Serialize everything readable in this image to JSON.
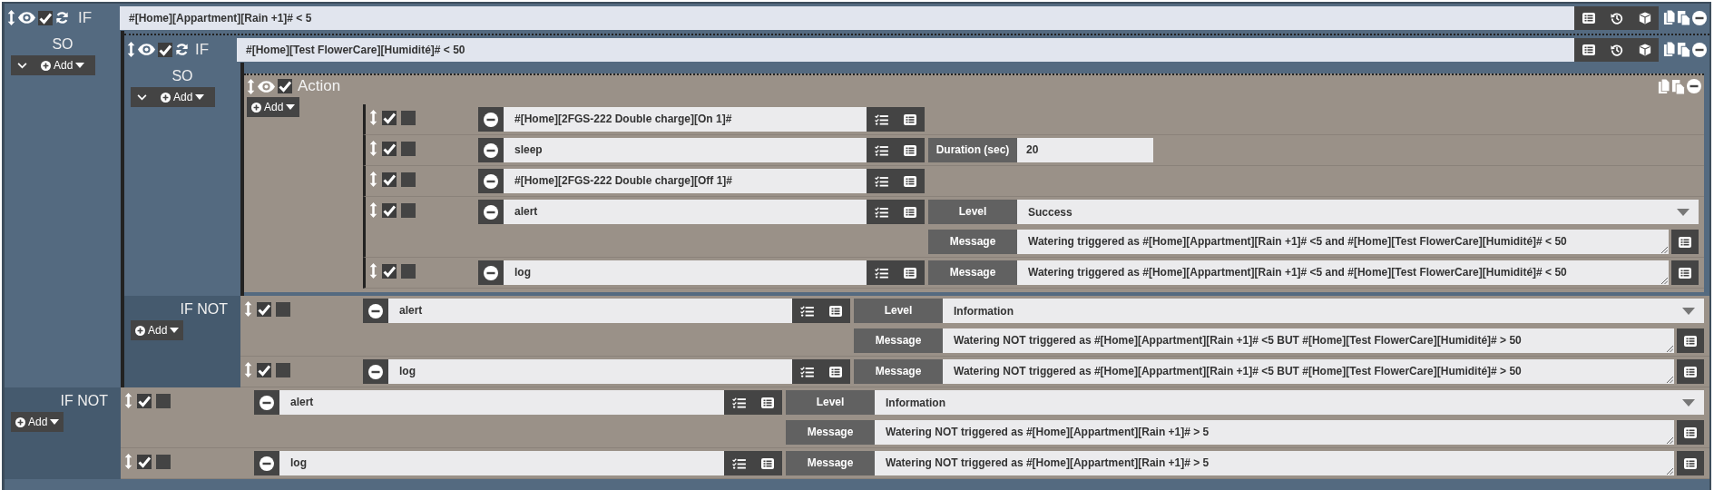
{
  "scenario": {
    "kind": "if",
    "keyword": "IF",
    "enabled": true,
    "condition": "#[Home][Appartment][Rain +1]# < 5",
    "then": {
      "label": "SO",
      "collapsible": true,
      "add_label": "Add",
      "items": [
        {
          "kind": "if",
          "keyword": "IF",
          "enabled": true,
          "condition": "#[Home][Test FlowerCare][Humidité]# < 50",
          "then": {
            "label": "SO",
            "collapsible": true,
            "add_label": "Add",
            "items": [
              {
                "kind": "action",
                "title": "Action",
                "enabled": true,
                "add_label": "Add",
                "items": [
                  {
                    "kind": "command",
                    "command": "#[Home][2FGS-222 Double charge][On 1]#",
                    "enabled": true,
                    "parallel": false
                  },
                  {
                    "kind": "command",
                    "command": "sleep",
                    "enabled": true,
                    "parallel": false,
                    "params": [
                      {
                        "kind": "input",
                        "label": "Duration (sec)",
                        "value": "20"
                      }
                    ]
                  },
                  {
                    "kind": "command",
                    "command": "#[Home][2FGS-222 Double charge][Off 1]#",
                    "enabled": true,
                    "parallel": false
                  },
                  {
                    "kind": "command",
                    "command": "alert",
                    "enabled": true,
                    "parallel": false,
                    "params": [
                      {
                        "kind": "select",
                        "label": "Level",
                        "value": "Success"
                      },
                      {
                        "kind": "textarea",
                        "label": "Message",
                        "value": "Watering triggered as #[Home][Appartment][Rain +1]# <5 and #[Home][Test FlowerCare][Humidité]# < 50"
                      }
                    ]
                  },
                  {
                    "kind": "command",
                    "command": "log",
                    "enabled": true,
                    "parallel": false,
                    "params": [
                      {
                        "kind": "textarea",
                        "label": "Message",
                        "value": "Watering triggered as #[Home][Appartment][Rain +1]# <5 and #[Home][Test FlowerCare][Humidité]# < 50"
                      }
                    ]
                  }
                ]
              }
            ]
          },
          "else": {
            "label": "IF NOT",
            "collapsible": false,
            "add_label": "Add",
            "items": [
              {
                "kind": "command",
                "command": "alert",
                "enabled": true,
                "parallel": false,
                "params": [
                  {
                    "kind": "select",
                    "label": "Level",
                    "value": "Information"
                  },
                  {
                    "kind": "textarea",
                    "label": "Message",
                    "value": "Watering NOT triggered as #[Home][Appartment][Rain +1]# <5 BUT #[Home][Test FlowerCare][Humidité]# > 50"
                  }
                ]
              },
              {
                "kind": "command",
                "command": "log",
                "enabled": true,
                "parallel": false,
                "params": [
                  {
                    "kind": "textarea",
                    "label": "Message",
                    "value": "Watering NOT triggered as #[Home][Appartment][Rain +1]# <5 BUT #[Home][Test FlowerCare][Humidité]# > 50"
                  }
                ]
              }
            ]
          }
        }
      ]
    },
    "else": {
      "label": "IF NOT",
      "collapsible": false,
      "add_label": "Add",
      "items": [
        {
          "kind": "command",
          "command": "alert",
          "enabled": true,
          "parallel": false,
          "params": [
            {
              "kind": "select",
              "label": "Level",
              "value": "Information"
            },
            {
              "kind": "textarea",
              "label": "Message",
              "value": "Watering NOT triggered as #[Home][Appartment][Rain +1]# > 5"
            }
          ]
        },
        {
          "kind": "command",
          "command": "log",
          "enabled": true,
          "parallel": false,
          "params": [
            {
              "kind": "textarea",
              "label": "Message",
              "value": "Watering NOT triggered as #[Home][Appartment][Rain +1]# > 5"
            }
          ]
        }
      ]
    }
  }
}
